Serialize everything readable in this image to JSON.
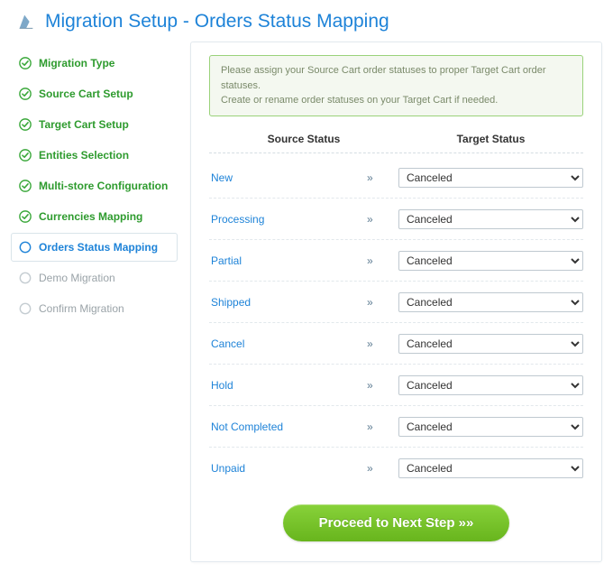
{
  "header": {
    "title": "Migration Setup - Orders Status Mapping"
  },
  "sidebar": {
    "steps": [
      {
        "label": "Migration Type",
        "state": "completed"
      },
      {
        "label": "Source Cart Setup",
        "state": "completed"
      },
      {
        "label": "Target Cart Setup",
        "state": "completed"
      },
      {
        "label": "Entities Selection",
        "state": "completed"
      },
      {
        "label": "Multi-store Configuration",
        "state": "completed"
      },
      {
        "label": "Currencies Mapping",
        "state": "completed"
      },
      {
        "label": "Orders Status Mapping",
        "state": "current"
      },
      {
        "label": "Demo Migration",
        "state": "pending"
      },
      {
        "label": "Confirm Migration",
        "state": "pending"
      }
    ]
  },
  "notice": {
    "line1": "Please assign your Source Cart order statuses to proper Target Cart order statuses.",
    "line2": "Create or rename order statuses on your Target Cart if needed."
  },
  "columns": {
    "source": "Source Status",
    "target": "Target Status"
  },
  "arrow_glyph": "»",
  "mappings": [
    {
      "source": "New",
      "target": "Canceled"
    },
    {
      "source": "Processing",
      "target": "Canceled"
    },
    {
      "source": "Partial",
      "target": "Canceled"
    },
    {
      "source": "Shipped",
      "target": "Canceled"
    },
    {
      "source": "Cancel",
      "target": "Canceled"
    },
    {
      "source": "Hold",
      "target": "Canceled"
    },
    {
      "source": "Not Completed",
      "target": "Canceled"
    },
    {
      "source": "Unpaid",
      "target": "Canceled"
    }
  ],
  "proceed_label": "Proceed to Next Step »»"
}
